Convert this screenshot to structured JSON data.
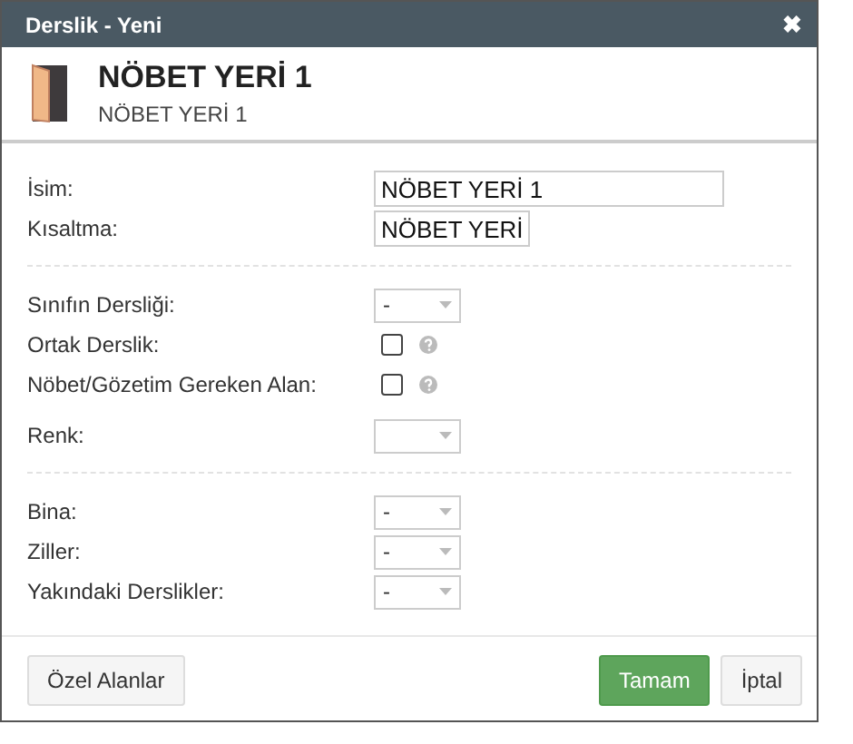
{
  "window": {
    "title": "Derslik - Yeni",
    "close": "✖"
  },
  "header": {
    "title": "NÖBET YERİ 1",
    "subtitle": "NÖBET YERİ 1"
  },
  "groups": [
    {
      "fields": [
        {
          "kind": "name",
          "label": "İsim:",
          "value": "NÖBET YERİ 1"
        },
        {
          "kind": "abbreviation",
          "label": "Kısaltma:",
          "value": "NÖBET YERİ"
        }
      ]
    },
    {
      "fields": [
        {
          "kind": "select",
          "label": "Sınıfın Dersliği:",
          "value": "-"
        },
        {
          "kind": "checkbox",
          "label": "Ortak Derslik:",
          "checked": false,
          "help": true
        },
        {
          "kind": "checkbox",
          "label": "Nöbet/Gözetim Gereken Alan:",
          "checked": false,
          "help": true
        },
        {
          "kind": "color",
          "label": "Renk:"
        }
      ]
    },
    {
      "fields": [
        {
          "kind": "select",
          "label": "Bina:",
          "value": "-"
        },
        {
          "kind": "select",
          "label": "Ziller:",
          "value": "-"
        },
        {
          "kind": "select",
          "label": "Yakındaki Derslikler:",
          "value": "-"
        }
      ]
    }
  ],
  "footer": {
    "left": [
      {
        "label": "Özel Alanlar",
        "kind": "default"
      }
    ],
    "right": [
      {
        "label": "Tamam",
        "kind": "primary"
      },
      {
        "label": "İptal",
        "kind": "default"
      }
    ]
  }
}
